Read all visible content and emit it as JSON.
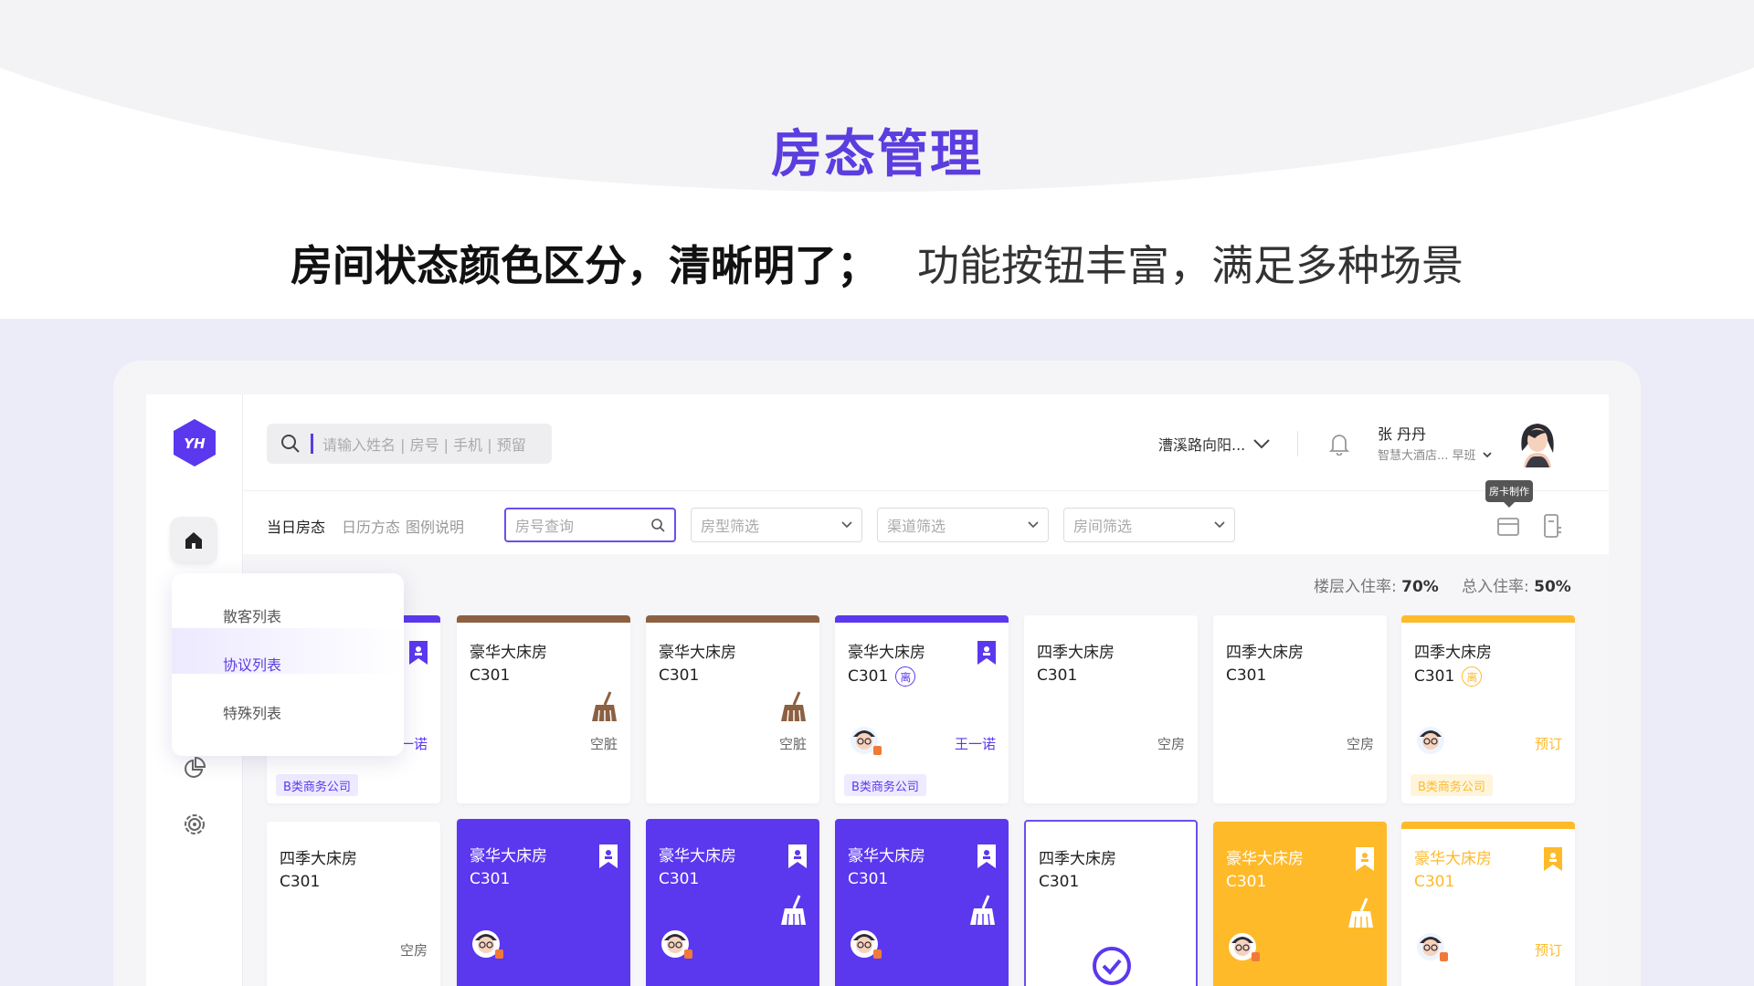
{
  "hero": {
    "title": "房态管理",
    "subtitle_bold": "房间状态颜色区分，清晰明了；",
    "subtitle_light": "功能按钮丰富，满足多种场景"
  },
  "colors": {
    "accent": "#5b38ee",
    "yellow": "#ffba2a",
    "brown": "#8b6142",
    "band": "#ececf9"
  },
  "sidebar": {
    "logo_text": "YH",
    "icons": [
      "home-icon",
      "pie-chart-icon",
      "settings-icon"
    ]
  },
  "topbar": {
    "search_placeholder": "请输入姓名 | 房号 | 手机 | 预留",
    "hotel": "漕溪路向阳...",
    "user_name": "张 丹丹",
    "user_sub": "智慧大酒店... 早班"
  },
  "bar2": {
    "tabs": [
      "当日房态",
      "日历方态",
      "图例说明"
    ],
    "room_search_placeholder": "房号查询",
    "filters": [
      "房型筛选",
      "渠道筛选",
      "房间筛选"
    ],
    "tooltip": "房卡制作"
  },
  "occupancy": {
    "floor_label": "楼层入住率:",
    "floor_value": "70%",
    "total_label": "总入住率:",
    "total_value": "50%"
  },
  "menu": {
    "items": [
      "散客列表",
      "协议列表",
      "特殊列表"
    ]
  },
  "rooms": [
    {
      "name": "",
      "number": "",
      "status": "一诺",
      "tag": "B类商务公司"
    },
    {
      "name": "豪华大床房",
      "number": "C301",
      "status": "空脏",
      "tag": ""
    },
    {
      "name": "豪华大床房",
      "number": "C301",
      "status": "空脏",
      "tag": ""
    },
    {
      "name": "豪华大床房",
      "number": "C301",
      "badge": "离",
      "status": "王一诺",
      "tag": "B类商务公司"
    },
    {
      "name": "四季大床房",
      "number": "C301",
      "status": "空房",
      "tag": ""
    },
    {
      "name": "四季大床房",
      "number": "C301",
      "status": "空房",
      "tag": ""
    },
    {
      "name": "四季大床房",
      "number": "C301",
      "badge": "离",
      "status": "预订",
      "tag": "B类商务公司"
    },
    {
      "name": "四季大床房",
      "number": "C301",
      "status": "空房",
      "tag": ""
    },
    {
      "name": "豪华大床房",
      "number": "C301",
      "status": "",
      "tag": ""
    },
    {
      "name": "豪华大床房",
      "number": "C301",
      "status": "",
      "tag": ""
    },
    {
      "name": "豪华大床房",
      "number": "C301",
      "status": "",
      "tag": ""
    },
    {
      "name": "四季大床房",
      "number": "C301",
      "status": "",
      "tag": ""
    },
    {
      "name": "豪华大床房",
      "number": "C301",
      "status": "",
      "tag": ""
    },
    {
      "name": "豪华大床房",
      "number": "C301",
      "status": "预订",
      "tag": ""
    }
  ]
}
